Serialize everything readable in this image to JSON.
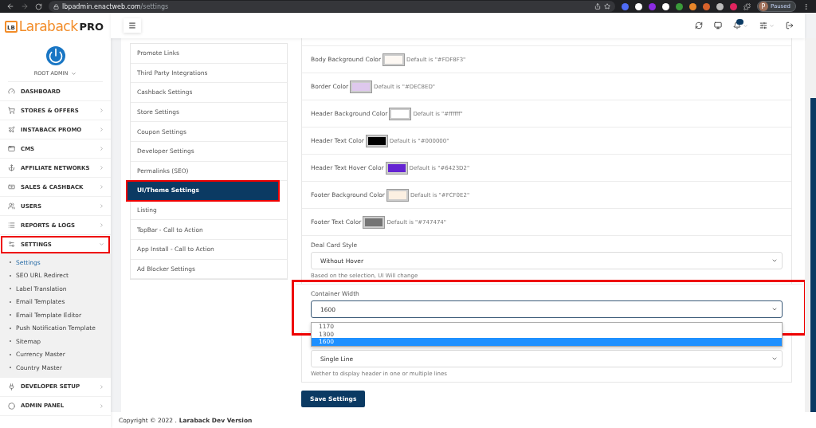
{
  "browser": {
    "url_host": "lbpadmin.enactweb.com",
    "url_path": "/settings",
    "profile_initial": "P",
    "profile_status": "Paused"
  },
  "sidebar": {
    "logo": {
      "main": "Laraback",
      "suffix": "PRO",
      "badge": "LB"
    },
    "user": "ROOT ADMIN",
    "items": [
      {
        "label": "DASHBOARD",
        "kind": "link",
        "highlighted": false
      },
      {
        "label": "STORES & OFFERS",
        "kind": "menu",
        "expanded": false,
        "highlighted": false
      },
      {
        "label": "INSTABACK PROMO",
        "kind": "menu",
        "expanded": false,
        "highlighted": false
      },
      {
        "label": "CMS",
        "kind": "menu",
        "expanded": false,
        "highlighted": false
      },
      {
        "label": "AFFILIATE NETWORKS",
        "kind": "menu",
        "expanded": false,
        "highlighted": false
      },
      {
        "label": "SALES & CASHBACK",
        "kind": "menu",
        "expanded": false,
        "highlighted": false
      },
      {
        "label": "USERS",
        "kind": "menu",
        "expanded": false,
        "highlighted": false
      },
      {
        "label": "REPORTS & LOGS",
        "kind": "menu",
        "expanded": false,
        "highlighted": false
      },
      {
        "label": "SETTINGS",
        "kind": "menu",
        "expanded": true,
        "highlighted": true,
        "children": [
          {
            "label": "Settings",
            "selected": true
          },
          {
            "label": "SEO URL Redirect",
            "selected": false
          },
          {
            "label": "Label Translation",
            "selected": false
          },
          {
            "label": "Email Templates",
            "selected": false
          },
          {
            "label": "Email Template Editor",
            "selected": false
          },
          {
            "label": "Push Notification Template",
            "selected": false
          },
          {
            "label": "Sitemap",
            "selected": false
          },
          {
            "label": "Currency Master",
            "selected": false
          },
          {
            "label": "Country Master",
            "selected": false
          }
        ]
      },
      {
        "label": "DEVELOPER SETUP",
        "kind": "menu",
        "expanded": false,
        "highlighted": false
      },
      {
        "label": "ADMIN PANEL",
        "kind": "menu",
        "expanded": false,
        "highlighted": false
      }
    ]
  },
  "settings_tabs": [
    {
      "label": "Promote Links",
      "selected": false,
      "highlighted": false
    },
    {
      "label": "Third Party Integrations",
      "selected": false,
      "highlighted": false
    },
    {
      "label": "Cashback Settings",
      "selected": false,
      "highlighted": false
    },
    {
      "label": "Store Settings",
      "selected": false,
      "highlighted": false
    },
    {
      "label": "Coupon Settings",
      "selected": false,
      "highlighted": false
    },
    {
      "label": "Developer Settings",
      "selected": false,
      "highlighted": false
    },
    {
      "label": "Permalinks (SEO)",
      "selected": false,
      "highlighted": false
    },
    {
      "label": "UI/Theme Settings",
      "selected": true,
      "highlighted": true
    },
    {
      "label": "Listing",
      "selected": false,
      "highlighted": false
    },
    {
      "label": "TopBar - Call to Action",
      "selected": false,
      "highlighted": false
    },
    {
      "label": "App Install - Call to Action",
      "selected": false,
      "highlighted": false
    },
    {
      "label": "Ad Blocker Settings",
      "selected": false,
      "highlighted": false
    }
  ],
  "color_settings": [
    {
      "label": "Body Background Color",
      "color": "#fdf8f3",
      "default": "Default is \"#FDF8F3\""
    },
    {
      "label": "Border Color",
      "color": "#dec8ed",
      "default": "Default is \"#DEC8ED\""
    },
    {
      "label": "Header Background Color",
      "color": "#ffffff",
      "default": "Default is \"#ffffff\""
    },
    {
      "label": "Header Text Color",
      "color": "#000000",
      "default": "Default is \"#000000\""
    },
    {
      "label": "Header Text Hover Color",
      "color": "#6423d2",
      "default": "Default is \"#6423D2\""
    },
    {
      "label": "Footer Background Color",
      "color": "#fcf0e2",
      "default": "Default is \"#FCF0E2\""
    },
    {
      "label": "Footer Text Color",
      "color": "#747474",
      "default": "Default is \"#747474\""
    }
  ],
  "select_settings": [
    {
      "label": "Deal Card Style",
      "value": "Without Hover",
      "help": "Based on the selection, UI Will change",
      "highlighted": false,
      "expanded": false
    },
    {
      "label": "Container Width",
      "value": "1600",
      "highlighted": true,
      "expanded": true,
      "options": [
        {
          "label": "1170",
          "selected": false
        },
        {
          "label": "1300",
          "selected": false
        },
        {
          "label": "1600",
          "selected": true
        }
      ]
    },
    {
      "value": "Single Line",
      "help": "Wether to display header in one or multiple lines",
      "highlighted": false,
      "expanded": false
    }
  ],
  "save_button": "Save Settings",
  "footer": {
    "text": "Copyright © 2022 .",
    "brand": "Laraback Dev Version"
  }
}
